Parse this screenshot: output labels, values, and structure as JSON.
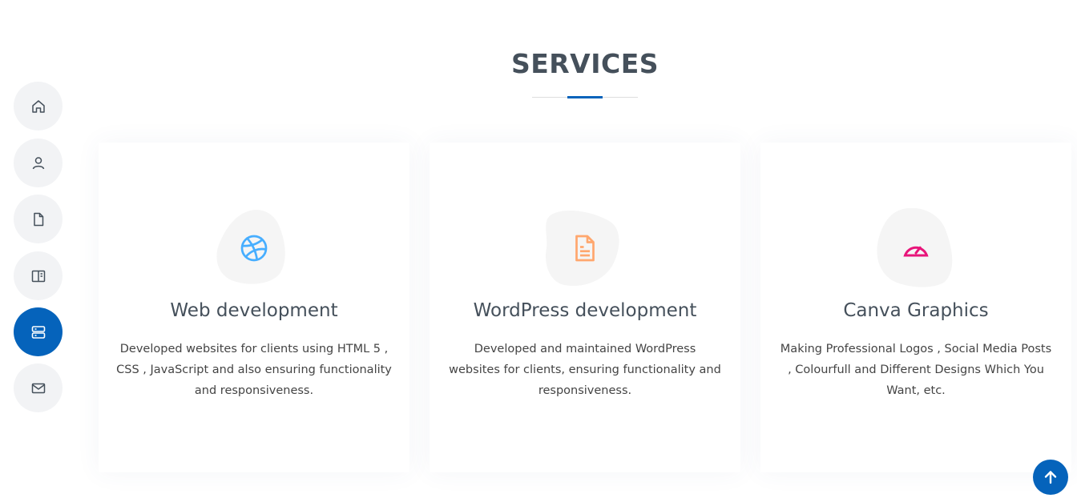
{
  "nav": {
    "items": [
      {
        "icon": "home-icon",
        "active": false
      },
      {
        "icon": "person-icon",
        "active": false
      },
      {
        "icon": "file-icon",
        "active": false
      },
      {
        "icon": "book-icon",
        "active": false
      },
      {
        "icon": "server-icon",
        "active": true
      },
      {
        "icon": "envelope-icon",
        "active": false
      }
    ]
  },
  "section": {
    "title": "SERVICES"
  },
  "services": [
    {
      "icon": "dribbble-icon",
      "icon_color": "#47aeff",
      "title": "Web development",
      "description": "Developed websites for clients using HTML 5 , CSS , JavaScript and also ensuring functionality and responsiveness."
    },
    {
      "icon": "file-text-icon",
      "icon_color": "#ffa76e",
      "title": "WordPress development",
      "description": "Developed and maintained WordPress websites for clients, ensuring functionality and responsiveness."
    },
    {
      "icon": "speedometer-icon",
      "icon_color": "#e9222c",
      "title": "Canva Graphics",
      "description": "Making Professional Logos , Social Media Posts , Colourfull and Different Designs Which You Want, etc."
    }
  ],
  "colors": {
    "accent": "#0563bb",
    "heading": "#45505b",
    "blob": "#f5f5f5"
  },
  "back_to_top": {
    "icon": "arrow-up-icon"
  }
}
